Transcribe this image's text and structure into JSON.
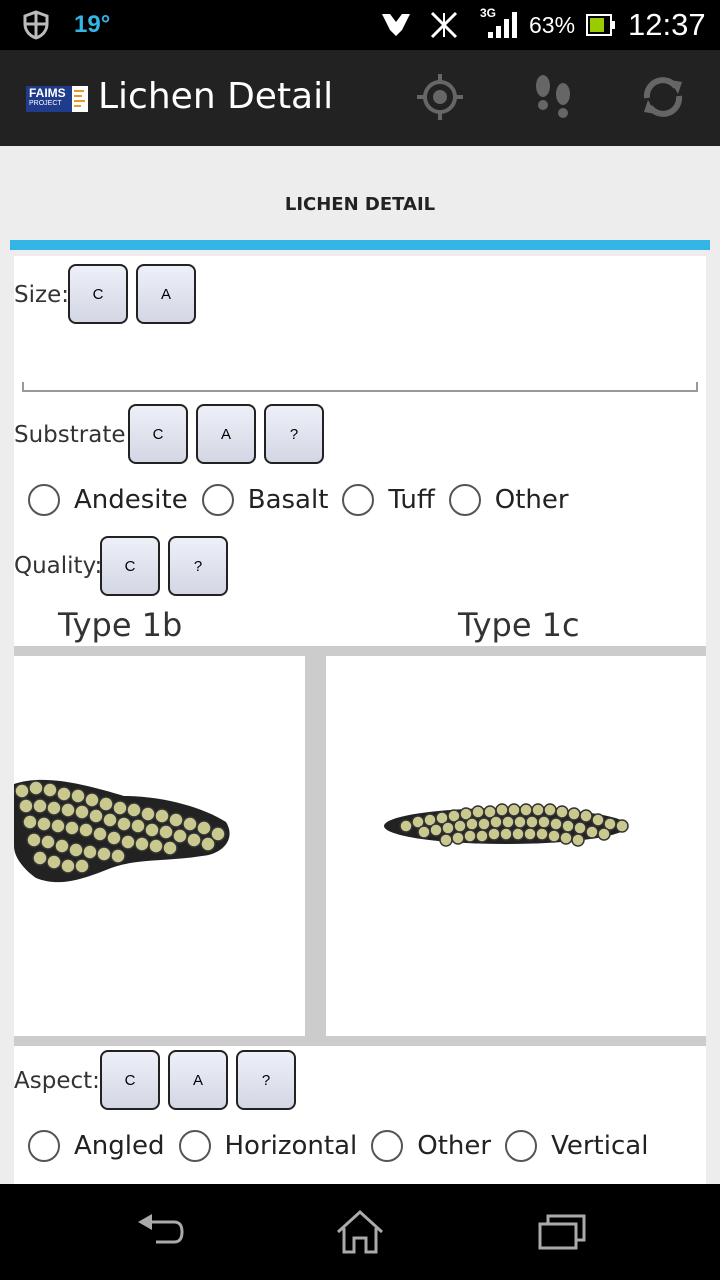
{
  "status": {
    "temperature": "19°",
    "network": "3G",
    "battery": "63%",
    "time": "12:37"
  },
  "appbar": {
    "logo_text": "FAIMS",
    "logo_sub": "PROJECT",
    "title": "Lichen Detail",
    "actions": [
      "gps-target-icon",
      "footsteps-icon",
      "sync-icon"
    ]
  },
  "tab": {
    "label": "LICHEN DETAIL",
    "accent": "#33b5e5"
  },
  "form": {
    "size": {
      "label": "Size:",
      "buttons": [
        "C",
        "A"
      ]
    },
    "substrate": {
      "label": "Substrate:",
      "buttons": [
        "C",
        "A",
        "?"
      ],
      "options": [
        "Andesite",
        "Basalt",
        "Tuff",
        "Other"
      ]
    },
    "quality": {
      "label": "Quality:",
      "buttons": [
        "C",
        "?"
      ]
    },
    "types": [
      "Type 1b",
      "Type 1c"
    ],
    "aspect": {
      "label": "Aspect:",
      "buttons": [
        "C",
        "A",
        "?"
      ],
      "options": [
        "Angled",
        "Horizontal",
        "Other",
        "Vertical"
      ]
    }
  },
  "nav": [
    "back-icon",
    "home-icon",
    "recent-apps-icon"
  ]
}
